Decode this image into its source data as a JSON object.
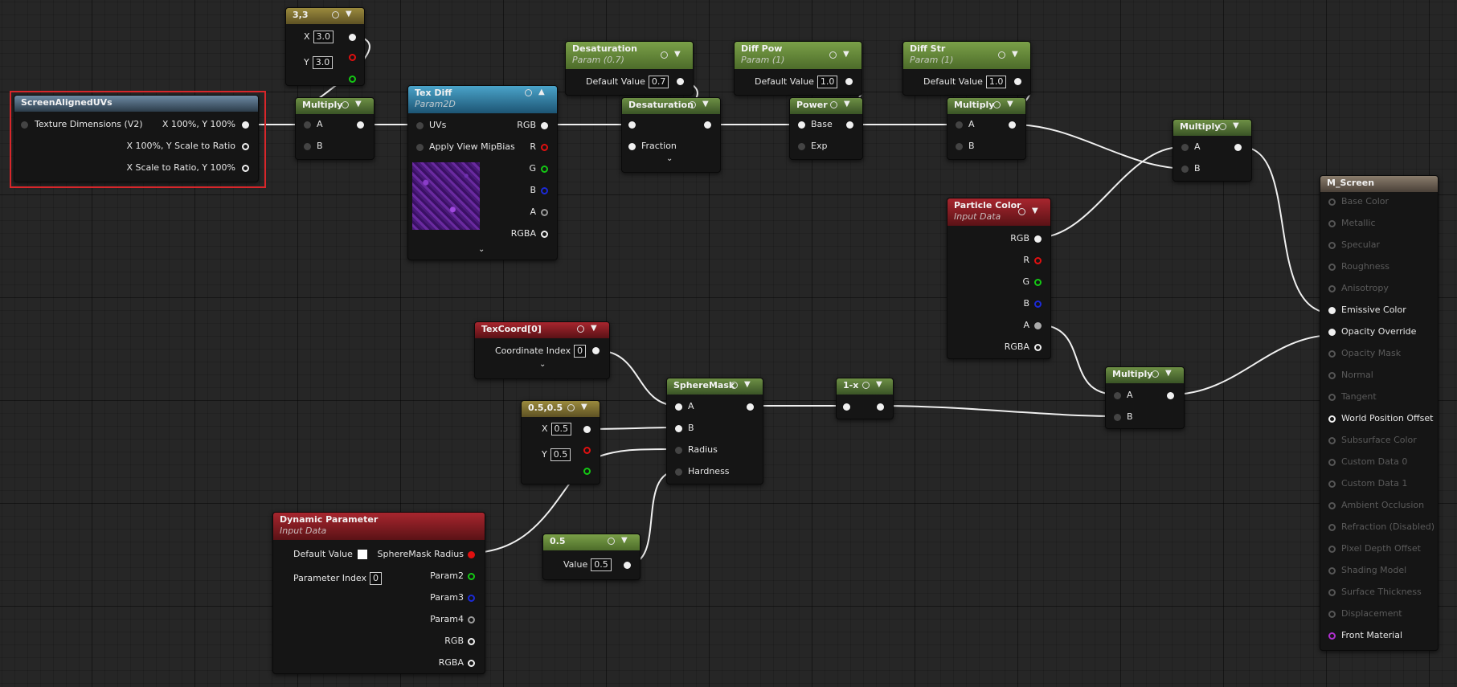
{
  "nodes": {
    "const33": {
      "title": "3,3",
      "x_label": "X",
      "x_value": "3.0",
      "y_label": "Y",
      "y_value": "3.0"
    },
    "screen_uvs": {
      "title": "ScreenAlignedUVs",
      "pin_in": "Texture Dimensions (V2)",
      "out1": "X 100%, Y 100%",
      "out2": "X 100%, Y Scale to Ratio",
      "out3": "X Scale to Ratio, Y 100%"
    },
    "multiply1": {
      "title": "Multiply",
      "a": "A",
      "b": "B"
    },
    "tex_diff": {
      "title": "Tex Diff",
      "subtitle": "Param2D",
      "uvs": "UVs",
      "mip": "Apply View MipBias",
      "rgb": "RGB",
      "r": "R",
      "g": "G",
      "b": "B",
      "a": "A",
      "rgba": "RGBA"
    },
    "desat_param": {
      "title": "Desaturation",
      "subtitle": "Param (0.7)",
      "label": "Default Value",
      "value": "0.7"
    },
    "desat": {
      "title": "Desaturation",
      "fraction": "Fraction"
    },
    "diffpow_param": {
      "title": "Diff Pow",
      "subtitle": "Param (1)",
      "label": "Default Value",
      "value": "1.0"
    },
    "power": {
      "title": "Power",
      "base": "Base",
      "exp": "Exp"
    },
    "diffstr_param": {
      "title": "Diff Str",
      "subtitle": "Param (1)",
      "label": "Default Value",
      "value": "1.0"
    },
    "multiply2": {
      "title": "Multiply",
      "a": "A",
      "b": "B"
    },
    "multiply3": {
      "title": "Multiply",
      "a": "A",
      "b": "B"
    },
    "particle_color": {
      "title": "Particle Color",
      "subtitle": "Input Data",
      "rgb": "RGB",
      "r": "R",
      "g": "G",
      "b": "B",
      "a": "A",
      "rgba": "RGBA"
    },
    "texcoord": {
      "title": "TexCoord[0]",
      "label": "Coordinate Index",
      "value": "0"
    },
    "spheremask": {
      "title": "SphereMask",
      "a": "A",
      "b": "B",
      "radius": "Radius",
      "hardness": "Hardness"
    },
    "one_minus": {
      "title": "1-x"
    },
    "const05": {
      "title": "0.5,0.5",
      "x_label": "X",
      "x_value": "0.5",
      "y_label": "Y",
      "y_value": "0.5"
    },
    "multiply4": {
      "title": "Multiply",
      "a": "A",
      "b": "B"
    },
    "dyn_param": {
      "title": "Dynamic Parameter",
      "subtitle": "Input Data",
      "default_label": "Default Value",
      "index_label": "Parameter Index",
      "index_value": "0",
      "out1": "SphereMask Radius",
      "out2": "Param2",
      "out3": "Param3",
      "out4": "Param4",
      "out5": "RGB",
      "out6": "RGBA"
    },
    "scalar05": {
      "title": "0.5",
      "label": "Value",
      "value": "0.5"
    },
    "m_screen": {
      "title": "M_Screen",
      "inputs": [
        "Base Color",
        "Metallic",
        "Specular",
        "Roughness",
        "Anisotropy",
        "Emissive Color",
        "Opacity Override",
        "Opacity Mask",
        "Normal",
        "Tangent",
        "World Position Offset",
        "Subsurface Color",
        "Custom Data 0",
        "Custom Data 1",
        "Ambient Occlusion",
        "Refraction (Disabled)",
        "Pixel Depth Offset",
        "Shading Model",
        "Surface Thickness",
        "Displacement",
        "Front Material"
      ]
    }
  },
  "colors": {
    "selection": "#d8262a",
    "wire": "#f0f0f0",
    "red_pin": "#e01010",
    "green_pin": "#14c814",
    "blue_pin": "#1c2ad8",
    "purple_pin": "#b030d0"
  }
}
